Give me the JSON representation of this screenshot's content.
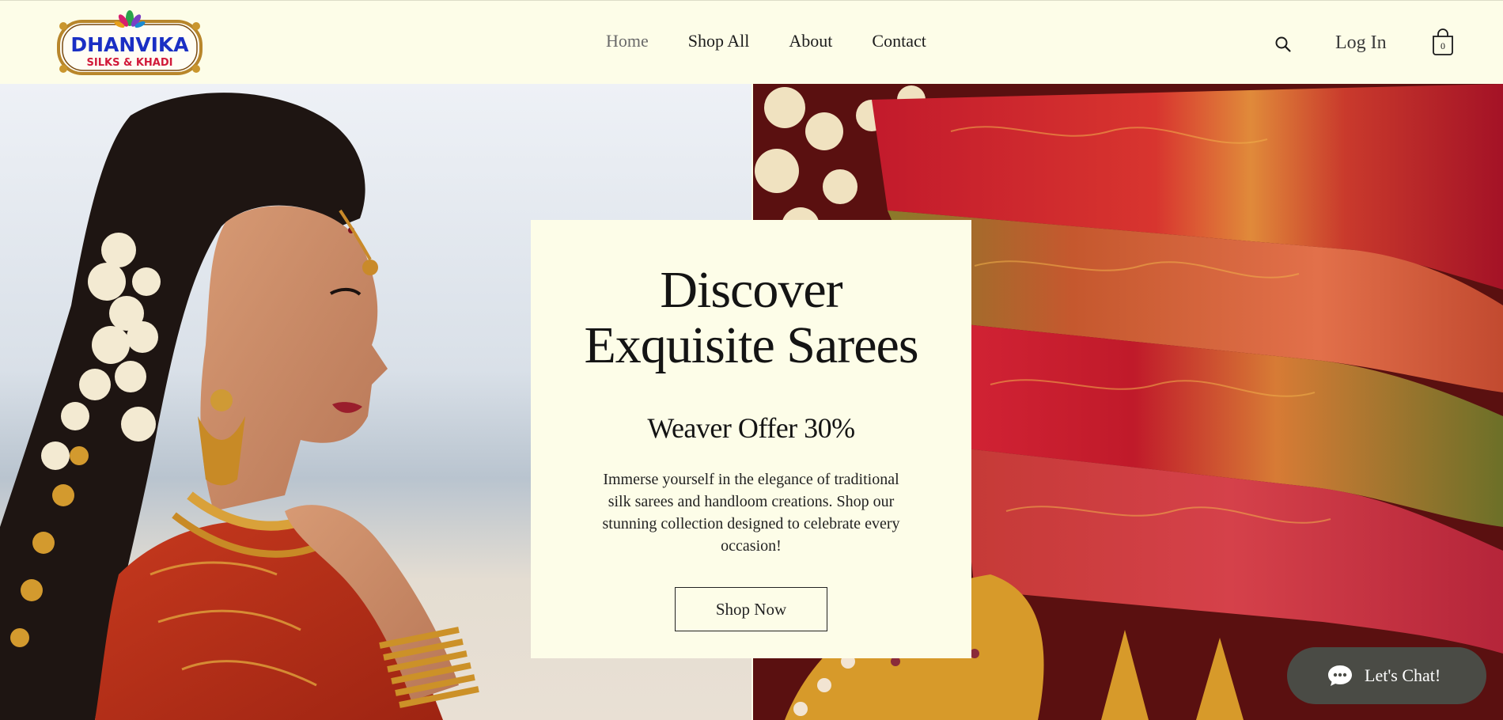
{
  "brand": {
    "line1": "DHANVIKA",
    "line2": "SILKS & KHADI"
  },
  "nav": [
    {
      "label": "Home",
      "active": true
    },
    {
      "label": "Shop All"
    },
    {
      "label": "About"
    },
    {
      "label": "Contact"
    }
  ],
  "header": {
    "login_label": "Log In",
    "cart_count": "0"
  },
  "hero": {
    "title_line1": "Discover",
    "title_line2": "Exquisite Sarees",
    "subtitle": "Weaver Offer 30%",
    "body": "Immerse yourself in the elegance of traditional silk sarees and handloom creations. Shop our stunning collection designed to celebrate every occasion!",
    "cta_label": "Shop Now"
  },
  "chat": {
    "label": "Let's Chat!"
  },
  "colors": {
    "background": "#fdfde8",
    "chat_bg": "#4a4b45",
    "logo_blue": "#1a2fc4",
    "logo_red": "#d11a3a"
  }
}
